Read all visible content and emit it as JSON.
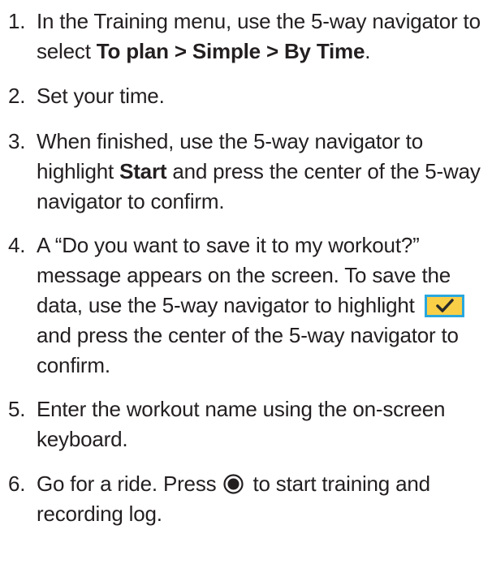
{
  "steps": [
    {
      "number": "1.",
      "segments": {
        "s1": "In the Training menu, use the 5-way navigator to select ",
        "b1": "To plan > Simple > By Time",
        "s2": "."
      }
    },
    {
      "number": "2.",
      "segments": {
        "s1": "Set your time."
      }
    },
    {
      "number": "3.",
      "segments": {
        "s1": "When finished, use the 5-way navigator to highlight ",
        "b1": "Start",
        "s2": " and press the center of the 5-way navigator to confirm."
      }
    },
    {
      "number": "4.",
      "segments": {
        "s1": "A “Do you want to save it to my workout?” message appears on the screen. To save the data, use the 5-way navigator to highlight",
        "s2": "and press the center of the 5-way navigator to confirm."
      },
      "icon": "checkmark-confirm-icon"
    },
    {
      "number": "5.",
      "segments": {
        "s1": "Enter the workout name using the on-screen keyboard."
      }
    },
    {
      "number": "6.",
      "segments": {
        "s1": "Go for a ride. Press",
        "s2": "to start training and recording log."
      },
      "icon": "record-button-icon"
    }
  ],
  "colors": {
    "text": "#231f20",
    "check_fill": "#f9cf47",
    "check_border": "#29a7de"
  }
}
